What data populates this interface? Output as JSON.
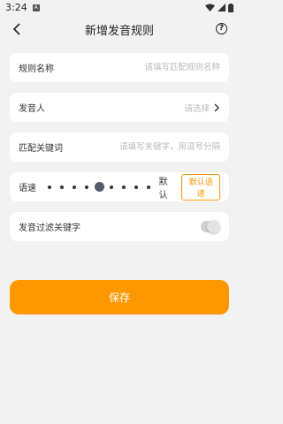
{
  "status_bar": {
    "time": "3:24",
    "app_icon": "A"
  },
  "header": {
    "title": "新增发音规则",
    "help": "?"
  },
  "form": {
    "rule_name": {
      "label": "规则名称",
      "placeholder": "请填写匹配规则名称"
    },
    "voice": {
      "label": "发音人",
      "value": "请选择"
    },
    "keywords": {
      "label": "匹配关键词",
      "placeholder": "请填写关键字，用逗号分隔"
    },
    "speed": {
      "label": "语速",
      "value": "默认",
      "default_button": "默认语速",
      "level": 5,
      "levels": 9
    },
    "filter_keywords": {
      "label": "发音过滤关键字",
      "enabled": false
    }
  },
  "save_button": "保存",
  "colors": {
    "accent": "#ff9800",
    "background": "#f2f2f2"
  }
}
